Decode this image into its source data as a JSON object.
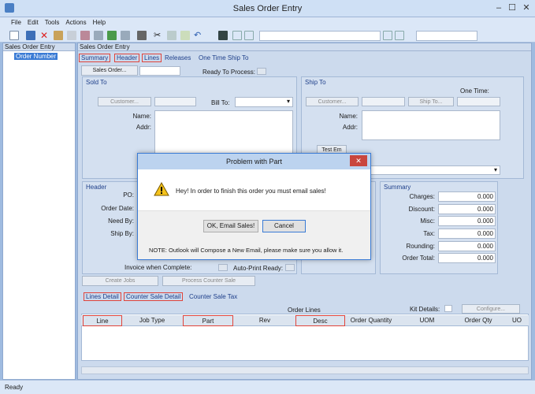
{
  "window": {
    "title": "Sales Order Entry",
    "status": "Ready"
  },
  "menu": [
    "File",
    "Edit",
    "Tools",
    "Actions",
    "Help"
  ],
  "tree": {
    "header": "Sales Order Entry",
    "item": "Order Number"
  },
  "main": {
    "header": "Sales Order Entry",
    "tabs": [
      "Summary",
      "Header",
      "Lines",
      "Releases",
      "One Time Ship To"
    ],
    "sales_order_button": "Sales Order...",
    "ready_to_process": "Ready To Process:",
    "sold_to": {
      "label": "Sold To",
      "customer_button": "Customer...",
      "bill_to": "Bill To:",
      "name": "Name:",
      "addr": "Addr:"
    },
    "ship_to": {
      "label": "Ship To",
      "one_time": "One Time:",
      "customer_button": "Customer...",
      "ship_to_button": "Ship To...",
      "name": "Name:",
      "addr": "Addr:",
      "test_button": "Test Em"
    },
    "header_group": {
      "label": "Header",
      "po": "PO:",
      "order_date": "Order Date:",
      "need_by": "Need By:",
      "ship_by": "Ship By:",
      "invoice_complete": "Invoice when Complete:",
      "auto_print": "Auto-Print Ready:"
    },
    "summary_group": {
      "label": "Summary",
      "rows": [
        {
          "label": "Charges:",
          "value": "0.000"
        },
        {
          "label": "Discount:",
          "value": "0.000"
        },
        {
          "label": "Misc:",
          "value": "0.000"
        },
        {
          "label": "Tax:",
          "value": "0.000"
        },
        {
          "label": "Rounding:",
          "value": "0.000"
        },
        {
          "label": "Order Total:",
          "value": "0.000"
        }
      ]
    },
    "create_jobs": "Create Jobs",
    "process_counter": "Process Counter Sale",
    "bottom_tabs": [
      "Lines Detail",
      "Counter Sale Detail",
      "Counter Sale Tax"
    ],
    "order_lines_label": "Order Lines",
    "kit_details": "Kit Details:",
    "configure_button": "Configure...",
    "grid_columns": [
      "Line",
      "Job Type",
      "Part",
      "Rev",
      "Desc",
      "Order Quantity",
      "UOM",
      "Order Qty",
      "UO"
    ]
  },
  "dialog": {
    "title": "Problem with Part",
    "message": "Hey! In order to finish this order you must email sales!",
    "ok_button": "OK, Email Sales!",
    "cancel_button": "Cancel",
    "note": "NOTE: Outlook will Compose a New Email, please make sure you allow it."
  }
}
